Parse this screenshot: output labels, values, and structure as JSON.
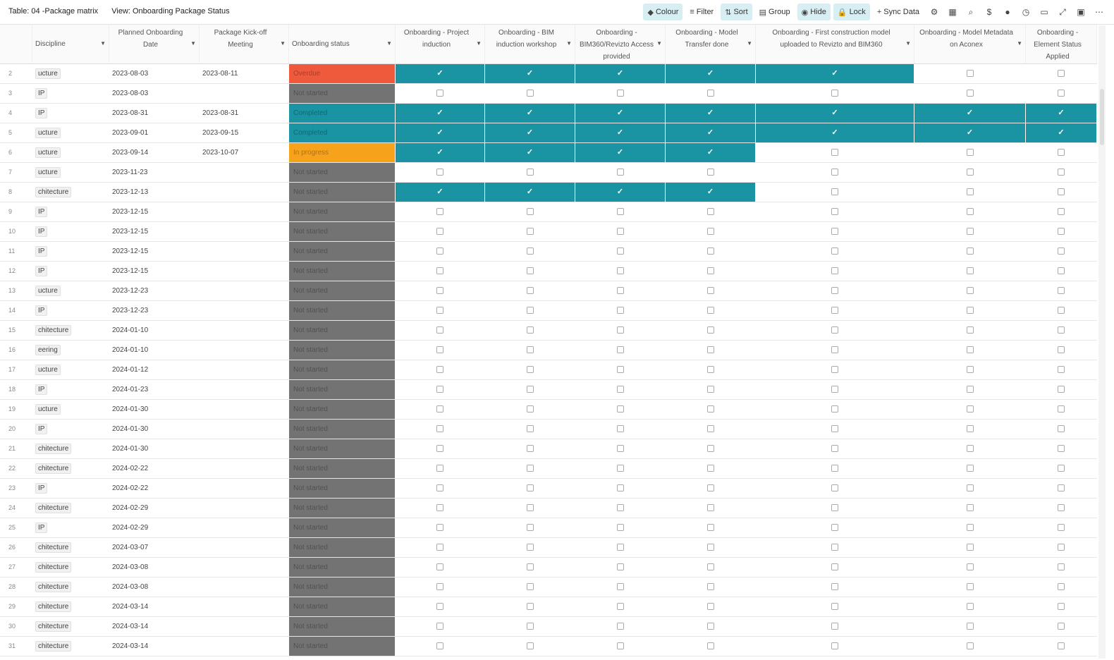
{
  "toolbar": {
    "table_label": "Table: 04 -Package matrix",
    "view_label": "View: Onboarding Package Status",
    "buttons": [
      {
        "label": "Colour",
        "glyph": "◆",
        "active": true,
        "name": "colour-button"
      },
      {
        "label": "Filter",
        "glyph": "≡",
        "active": false,
        "name": "filter-button"
      },
      {
        "label": "Sort",
        "glyph": "⇅",
        "active": true,
        "name": "sort-button"
      },
      {
        "label": "Group",
        "glyph": "▤",
        "active": false,
        "name": "group-button"
      },
      {
        "label": "Hide",
        "glyph": "◉",
        "active": true,
        "name": "hide-button"
      },
      {
        "label": "Lock",
        "glyph": "🔒",
        "active": true,
        "name": "lock-button"
      },
      {
        "label": "Sync Data",
        "glyph": "+",
        "active": false,
        "name": "sync-data-button"
      }
    ],
    "icons": [
      {
        "name": "settings-icon",
        "glyph": "⚙"
      },
      {
        "name": "table-icon",
        "glyph": "▦"
      },
      {
        "name": "search-icon",
        "glyph": "⌕"
      },
      {
        "name": "dollar-icon",
        "glyph": "$"
      },
      {
        "name": "user-icon",
        "glyph": "●"
      },
      {
        "name": "history-icon",
        "glyph": "◷"
      },
      {
        "name": "comments-icon",
        "glyph": "▭"
      },
      {
        "name": "expand-icon",
        "glyph": "⤢"
      },
      {
        "name": "save-icon",
        "glyph": "▣"
      },
      {
        "name": "more-icon",
        "glyph": "⋯"
      }
    ]
  },
  "colors": {
    "teal": "#1a94a3",
    "overdue": "#f05a3c",
    "in_progress": "#f7a21b",
    "not_started": "#737373",
    "completed": "#1a94a3"
  },
  "columns": [
    {
      "label": "",
      "type": "rownum",
      "name": "col-row-number"
    },
    {
      "label": "Discipline",
      "type": "discipline",
      "name": "col-discipline",
      "caret": true,
      "glyph": "≡"
    },
    {
      "label": "Planned Onboarding Date",
      "type": "date",
      "name": "col-planned-onboarding-date",
      "caret": true,
      "glyph": "≡"
    },
    {
      "label": "Package Kick-off Meeting",
      "type": "date",
      "name": "col-package-kickoff-meeting",
      "caret": true,
      "glyph": "◷"
    },
    {
      "label": "Onboarding status",
      "type": "status",
      "name": "col-onboarding-status",
      "caret": true,
      "glyph": "A"
    },
    {
      "label": "Onboarding - Project induction",
      "type": "check",
      "name": "col-project-induction",
      "caret": true,
      "glyph": "≡"
    },
    {
      "label": "Onboarding - BIM induction workshop",
      "type": "check",
      "name": "col-bim-induction",
      "caret": true,
      "glyph": "≡"
    },
    {
      "label": "Onboarding - BIM360/Revizto Access provided",
      "type": "check",
      "name": "col-bim360-access",
      "caret": true,
      "glyph": "≡"
    },
    {
      "label": "Onboarding - Model Transfer done",
      "type": "check",
      "name": "col-model-transfer",
      "caret": true,
      "glyph": "≡"
    },
    {
      "label": "Onboarding - First construction model uploaded to Revizto and BIM360",
      "type": "check",
      "name": "col-first-model-uploaded",
      "caret": true,
      "glyph": "≡"
    },
    {
      "label": "Onboarding - Model Metadata on Aconex",
      "type": "check",
      "name": "col-model-metadata",
      "caret": true,
      "glyph": "≡"
    },
    {
      "label": "Onboarding - Element Status Applied",
      "type": "check",
      "name": "col-element-status",
      "caret": false,
      "glyph": "≡"
    }
  ],
  "rows": [
    {
      "n": "2",
      "disc": "ucture",
      "planned": "2023-08-03",
      "kickoff": "2023-08-11",
      "status": "Overdue",
      "s": "overdue",
      "checks": [
        1,
        1,
        1,
        1,
        1,
        0,
        0
      ],
      "hl": 5
    },
    {
      "n": "3",
      "disc": "IP",
      "planned": "2023-08-03",
      "kickoff": "",
      "status": "Not started",
      "s": "not_started",
      "checks": [
        0,
        0,
        0,
        0,
        0,
        0,
        0
      ],
      "hl": 0
    },
    {
      "n": "4",
      "disc": "IP",
      "planned": "2023-08-31",
      "kickoff": "2023-08-31",
      "status": "Completed",
      "s": "completed",
      "checks": [
        1,
        1,
        1,
        1,
        1,
        1,
        1
      ],
      "hl": 7
    },
    {
      "n": "5",
      "disc": "ucture",
      "planned": "2023-09-01",
      "kickoff": "2023-09-15",
      "status": "Completed",
      "s": "completed",
      "checks": [
        1,
        1,
        1,
        1,
        1,
        1,
        1
      ],
      "hl": 7
    },
    {
      "n": "6",
      "disc": "ucture",
      "planned": "2023-09-14",
      "kickoff": "2023-10-07",
      "status": "In progress",
      "s": "in_progress",
      "checks": [
        1,
        1,
        1,
        1,
        0,
        0,
        0
      ],
      "hl": 4
    },
    {
      "n": "7",
      "disc": "ucture",
      "planned": "2023-11-23",
      "kickoff": "",
      "status": "Not started",
      "s": "not_started",
      "checks": [
        0,
        0,
        0,
        0,
        0,
        0,
        0
      ],
      "hl": 0
    },
    {
      "n": "8",
      "disc": "chitecture",
      "planned": "2023-12-13",
      "kickoff": "",
      "status": "Not started",
      "s": "not_started",
      "checks": [
        1,
        1,
        1,
        1,
        0,
        0,
        0
      ],
      "hl": 4
    },
    {
      "n": "9",
      "disc": "IP",
      "planned": "2023-12-15",
      "kickoff": "",
      "status": "Not started",
      "s": "not_started",
      "checks": [
        0,
        0,
        0,
        0,
        0,
        0,
        0
      ],
      "hl": 0
    },
    {
      "n": "10",
      "disc": "IP",
      "planned": "2023-12-15",
      "kickoff": "",
      "status": "Not started",
      "s": "not_started",
      "checks": [
        0,
        0,
        0,
        0,
        0,
        0,
        0
      ],
      "hl": 0
    },
    {
      "n": "11",
      "disc": "IP",
      "planned": "2023-12-15",
      "kickoff": "",
      "status": "Not started",
      "s": "not_started",
      "checks": [
        0,
        0,
        0,
        0,
        0,
        0,
        0
      ],
      "hl": 0
    },
    {
      "n": "12",
      "disc": "IP",
      "planned": "2023-12-15",
      "kickoff": "",
      "status": "Not started",
      "s": "not_started",
      "checks": [
        0,
        0,
        0,
        0,
        0,
        0,
        0
      ],
      "hl": 0
    },
    {
      "n": "13",
      "disc": "ucture",
      "planned": "2023-12-23",
      "kickoff": "",
      "status": "Not started",
      "s": "not_started",
      "checks": [
        0,
        0,
        0,
        0,
        0,
        0,
        0
      ],
      "hl": 0
    },
    {
      "n": "14",
      "disc": "IP",
      "planned": "2023-12-23",
      "kickoff": "",
      "status": "Not started",
      "s": "not_started",
      "checks": [
        0,
        0,
        0,
        0,
        0,
        0,
        0
      ],
      "hl": 0
    },
    {
      "n": "15",
      "disc": "chitecture",
      "planned": "2024-01-10",
      "kickoff": "",
      "status": "Not started",
      "s": "not_started",
      "checks": [
        0,
        0,
        0,
        0,
        0,
        0,
        0
      ],
      "hl": 0
    },
    {
      "n": "16",
      "disc": "eering",
      "planned": "2024-01-10",
      "kickoff": "",
      "status": "Not started",
      "s": "not_started",
      "checks": [
        0,
        0,
        0,
        0,
        0,
        0,
        0
      ],
      "hl": 0
    },
    {
      "n": "17",
      "disc": "ucture",
      "planned": "2024-01-12",
      "kickoff": "",
      "status": "Not started",
      "s": "not_started",
      "checks": [
        0,
        0,
        0,
        0,
        0,
        0,
        0
      ],
      "hl": 0
    },
    {
      "n": "18",
      "disc": "IP",
      "planned": "2024-01-23",
      "kickoff": "",
      "status": "Not started",
      "s": "not_started",
      "checks": [
        0,
        0,
        0,
        0,
        0,
        0,
        0
      ],
      "hl": 0
    },
    {
      "n": "19",
      "disc": "ucture",
      "planned": "2024-01-30",
      "kickoff": "",
      "status": "Not started",
      "s": "not_started",
      "checks": [
        0,
        0,
        0,
        0,
        0,
        0,
        0
      ],
      "hl": 0
    },
    {
      "n": "20",
      "disc": "IP",
      "planned": "2024-01-30",
      "kickoff": "",
      "status": "Not started",
      "s": "not_started",
      "checks": [
        0,
        0,
        0,
        0,
        0,
        0,
        0
      ],
      "hl": 0
    },
    {
      "n": "21",
      "disc": "chitecture",
      "planned": "2024-01-30",
      "kickoff": "",
      "status": "Not started",
      "s": "not_started",
      "checks": [
        0,
        0,
        0,
        0,
        0,
        0,
        0
      ],
      "hl": 0
    },
    {
      "n": "22",
      "disc": "chitecture",
      "planned": "2024-02-22",
      "kickoff": "",
      "status": "Not started",
      "s": "not_started",
      "checks": [
        0,
        0,
        0,
        0,
        0,
        0,
        0
      ],
      "hl": 0
    },
    {
      "n": "23",
      "disc": "IP",
      "planned": "2024-02-22",
      "kickoff": "",
      "status": "Not started",
      "s": "not_started",
      "checks": [
        0,
        0,
        0,
        0,
        0,
        0,
        0
      ],
      "hl": 0
    },
    {
      "n": "24",
      "disc": "chitecture",
      "planned": "2024-02-29",
      "kickoff": "",
      "status": "Not started",
      "s": "not_started",
      "checks": [
        0,
        0,
        0,
        0,
        0,
        0,
        0
      ],
      "hl": 0
    },
    {
      "n": "25",
      "disc": "IP",
      "planned": "2024-02-29",
      "kickoff": "",
      "status": "Not started",
      "s": "not_started",
      "checks": [
        0,
        0,
        0,
        0,
        0,
        0,
        0
      ],
      "hl": 0
    },
    {
      "n": "26",
      "disc": "chitecture",
      "planned": "2024-03-07",
      "kickoff": "",
      "status": "Not started",
      "s": "not_started",
      "checks": [
        0,
        0,
        0,
        0,
        0,
        0,
        0
      ],
      "hl": 0
    },
    {
      "n": "27",
      "disc": "chitecture",
      "planned": "2024-03-08",
      "kickoff": "",
      "status": "Not started",
      "s": "not_started",
      "checks": [
        0,
        0,
        0,
        0,
        0,
        0,
        0
      ],
      "hl": 0
    },
    {
      "n": "28",
      "disc": "chitecture",
      "planned": "2024-03-08",
      "kickoff": "",
      "status": "Not started",
      "s": "not_started",
      "checks": [
        0,
        0,
        0,
        0,
        0,
        0,
        0
      ],
      "hl": 0
    },
    {
      "n": "29",
      "disc": "chitecture",
      "planned": "2024-03-14",
      "kickoff": "",
      "status": "Not started",
      "s": "not_started",
      "checks": [
        0,
        0,
        0,
        0,
        0,
        0,
        0
      ],
      "hl": 0
    },
    {
      "n": "30",
      "disc": "chitecture",
      "planned": "2024-03-14",
      "kickoff": "",
      "status": "Not started",
      "s": "not_started",
      "checks": [
        0,
        0,
        0,
        0,
        0,
        0,
        0
      ],
      "hl": 0
    },
    {
      "n": "31",
      "disc": "chitecture",
      "planned": "2024-03-14",
      "kickoff": "",
      "status": "Not started",
      "s": "not_started",
      "checks": [
        0,
        0,
        0,
        0,
        0,
        0,
        0
      ],
      "hl": 0
    }
  ]
}
